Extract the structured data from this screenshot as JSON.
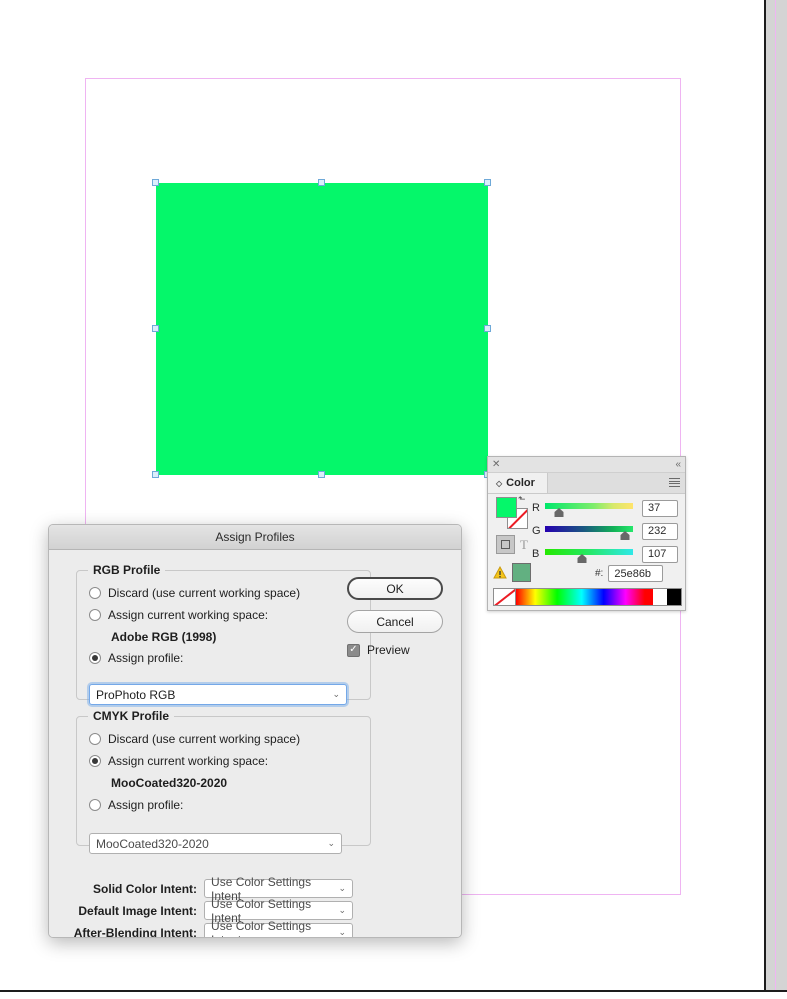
{
  "canvas": {
    "shape": {
      "fill_color": "#05f76a",
      "name": "green-rectangle"
    },
    "artboard_border_color": "#efb4f2"
  },
  "color_panel": {
    "tab_label": "Color",
    "close_icon": "close-icon",
    "collapse_icon": "collapse-panel-icon",
    "menu_icon": "panel-menu-icon",
    "fill_color": "#05f76a",
    "stroke_color": "none",
    "proof_color": "#62b081",
    "warning_icon": "out-of-gamut-warning-icon",
    "text_mode_label": "T",
    "hex_label": "#:",
    "hex_value": "25e86b",
    "channels": [
      {
        "label": "R",
        "value": "37"
      },
      {
        "label": "G",
        "value": "232"
      },
      {
        "label": "B",
        "value": "107"
      }
    ],
    "spectrum": {
      "none_swatch": "none-color-swatch",
      "white_swatch": "#ffffff",
      "black_swatch": "#000000"
    }
  },
  "dialog": {
    "title": "Assign Profiles",
    "rgb_group": {
      "legend": "RGB Profile",
      "discard_label": "Discard (use current working space)",
      "discard_selected": false,
      "working_space_label": "Assign current working space:",
      "working_space_selected": false,
      "working_space_name": "Adobe RGB (1998)",
      "assign_profile_label": "Assign profile:",
      "assign_profile_selected": true,
      "assign_profile_value": "ProPhoto RGB"
    },
    "cmyk_group": {
      "legend": "CMYK Profile",
      "discard_label": "Discard (use current working space)",
      "discard_selected": false,
      "working_space_label": "Assign current working space:",
      "working_space_selected": true,
      "working_space_name": "MooCoated320-2020",
      "assign_profile_label": "Assign profile:",
      "assign_profile_selected": false,
      "assign_profile_value": "MooCoated320-2020"
    },
    "intents": [
      {
        "label": "Solid Color Intent:",
        "value": "Use Color Settings Intent"
      },
      {
        "label": "Default Image Intent:",
        "value": "Use Color Settings Intent"
      },
      {
        "label": "After-Blending Intent:",
        "value": "Use Color Settings Intent"
      }
    ],
    "ok_label": "OK",
    "cancel_label": "Cancel",
    "preview_label": "Preview",
    "preview_checked": true,
    "checkmark": "✓"
  }
}
